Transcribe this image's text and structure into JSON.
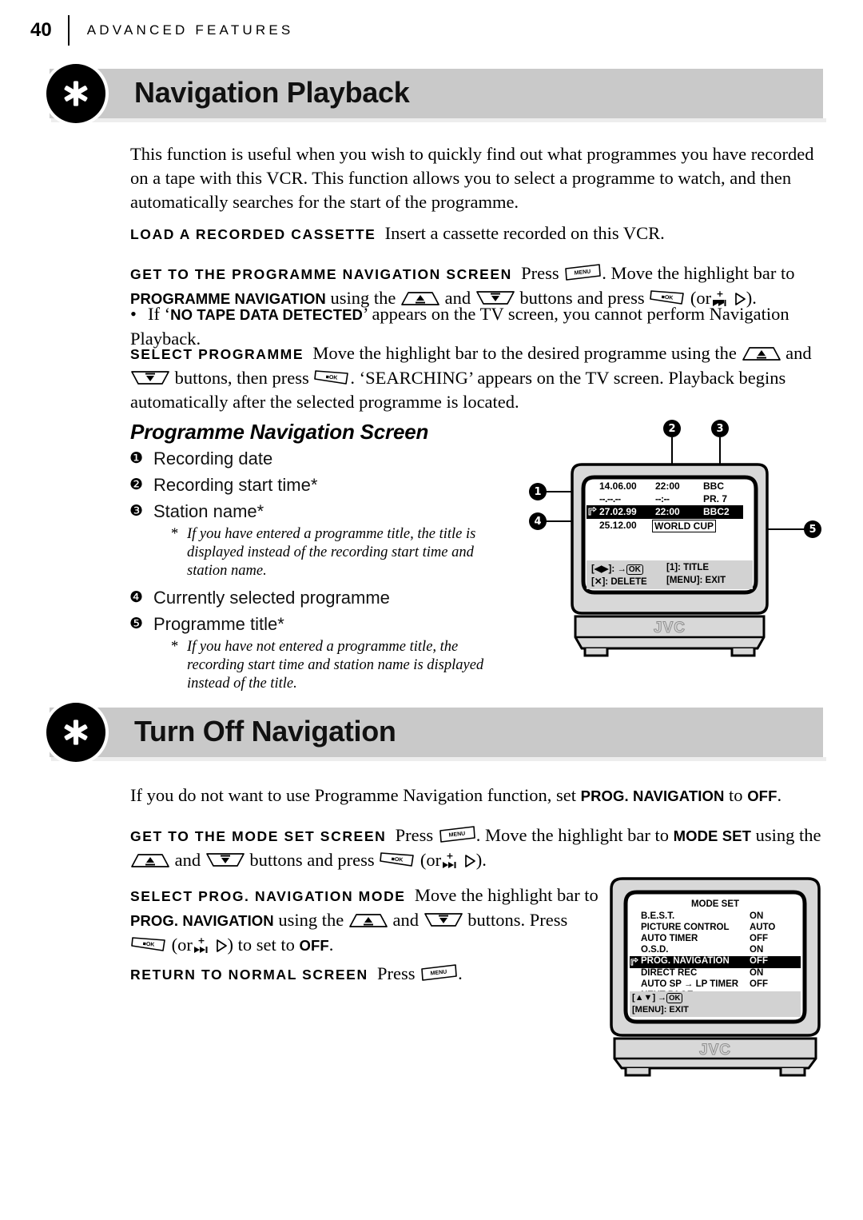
{
  "runhead": {
    "page_number": "40",
    "section": "ADVANCED FEATURES"
  },
  "sections": [
    {
      "id": "navigation-playback",
      "badge_icon": "asterisk-icon",
      "title": "Navigation Playback"
    },
    {
      "id": "turn-off-navigation",
      "badge_icon": "asterisk-icon",
      "title": "Turn Off Navigation"
    }
  ],
  "intro": {
    "line1": "This function is useful when you wish to quickly find out what programmes you have recorded",
    "line2": "on a tape with this VCR. This function allows you to select a programme to watch, and then",
    "line3": "automatically searches for the start of the programme."
  },
  "steps": {
    "load_cassette": {
      "lead": "LOAD A RECORDED CASSETTE",
      "body": "Insert a cassette recorded on this VCR."
    },
    "get_to_nav_screen": {
      "lead": "GET TO THE PROGRAMME NAVIGATION SCREEN",
      "body_a": "Press",
      "key_menu": "MENU",
      "body_b": ". Move the highlight bar to",
      "bold_target": "PROGRAMME NAVIGATION",
      "body_c": "using the",
      "key_up": "up-trapezoid-button",
      "body_d": "and",
      "key_down": "down-trapezoid-button",
      "body_e": "buttons and press",
      "key_ok": "OK",
      "body_f": "(or",
      "key_skip": "skip-forward-button",
      "key_play": "play-button",
      "body_g": ")."
    },
    "nav_note": {
      "dot": "•",
      "text_a": "If ‘",
      "bold": "NO TAPE DATA DETECTED",
      "text_b": "’ appears on the TV screen, you cannot perform Navigation Playback."
    },
    "select_programme": {
      "lead": "SELECT PROGRAMME",
      "body_a": "Move the highlight bar to the desired programme using the",
      "body_b": "and",
      "body_c": "buttons, then press",
      "body_d": ". ‘SEARCHING’ appears on the TV screen. Playback begins",
      "body_e": "automatically after the selected programme is located."
    },
    "get_to_mode_set": {
      "lead": "GET TO THE MODE SET SCREEN",
      "body_a": "Press",
      "body_b": ". Move the highlight bar to",
      "bold_target": "MODE SET",
      "body_c": "using the",
      "body_d": "and",
      "body_e": "buttons and press",
      "body_f": "(or",
      "body_g": ")."
    },
    "select_prog_nav_mode": {
      "lead": "SELECT PROG. NAVIGATION MODE",
      "body_a": "Move the highlight bar to",
      "bold_target": "PROG. NAVIGATION",
      "body_b": "using the",
      "body_c": "and",
      "body_d": "buttons. Press",
      "body_e": "(or",
      "body_f": ") to set to",
      "bold_off": "OFF",
      "body_g": "."
    },
    "return_normal": {
      "lead": "RETURN TO NORMAL SCREEN",
      "body_a": "Press",
      "body_b": "."
    }
  },
  "turn_off_intro": {
    "text_a": "If you do not want to use Programme Navigation function, set",
    "bold_a": "PROG. NAVIGATION",
    "text_b": "to",
    "bold_b": "OFF",
    "text_c": "."
  },
  "programme_nav_screen": {
    "heading": "Programme Navigation Screen",
    "legend": [
      {
        "num": "❶",
        "label": "Recording date",
        "note": null
      },
      {
        "num": "❷",
        "label": "Recording start time*",
        "note": null
      },
      {
        "num": "❸",
        "label": "Station name*",
        "note": "If you have entered a programme title, the title is displayed instead of the recording start time and station name."
      },
      {
        "num": "❹",
        "label": "Currently selected programme",
        "note": null
      },
      {
        "num": "❺",
        "label": "Programme title*",
        "note": "If you have not entered a programme title, the recording start time and station name is displayed instead of the title."
      }
    ],
    "callouts": [
      "1",
      "2",
      "3",
      "4",
      "5"
    ],
    "osd": {
      "rows": [
        {
          "marker": "",
          "date": "14.06.00",
          "time": "22:00",
          "station": "BBC",
          "highlighted": false
        },
        {
          "marker": "",
          "date": "--.--.--",
          "time": "--:--",
          "station": "PR. 7",
          "highlighted": false
        },
        {
          "marker": "hand-pointer-icon",
          "date": "27.02.99",
          "time": "22:00",
          "station": "BBC2",
          "highlighted": true
        },
        {
          "marker": "",
          "date": "25.12.00",
          "time": "WORLD CUP",
          "station": "",
          "highlighted": false
        }
      ],
      "footer": {
        "left_top": "[◀▶]: →",
        "left_top_key": "OK",
        "left_bottom": "[✕]: DELETE",
        "right_top": "[1]: TITLE",
        "right_bottom": "[MENU]: EXIT"
      },
      "brand": "JVC"
    }
  },
  "mode_set_screen": {
    "title": "MODE SET",
    "rows": [
      {
        "marker": "",
        "label": "B.E.S.T.",
        "value": "ON",
        "highlighted": false
      },
      {
        "marker": "",
        "label": "PICTURE CONTROL",
        "value": "AUTO",
        "highlighted": false
      },
      {
        "marker": "",
        "label": "AUTO TIMER",
        "value": "OFF",
        "highlighted": false
      },
      {
        "marker": "",
        "label": "O.S.D.",
        "value": "ON",
        "highlighted": false
      },
      {
        "marker": "hand-pointer-icon",
        "label": "PROG. NAVIGATION",
        "value": "OFF",
        "highlighted": true
      },
      {
        "marker": "",
        "label": "DIRECT REC",
        "value": "ON",
        "highlighted": false
      },
      {
        "marker": "",
        "label": "AUTO SP → LP TIMER",
        "value": "OFF",
        "highlighted": false
      },
      {
        "marker": "",
        "label": "NEXT PAGE",
        "value": "",
        "highlighted": false
      }
    ],
    "footer": {
      "left_top": "[▲▼] →",
      "left_top_key": "OK",
      "left_bottom": "[MENU]: EXIT"
    },
    "brand": "JVC"
  },
  "colors": {
    "banner_bar": "#c9c9c9",
    "banner_shadow": "#ededed",
    "tv_body": "#d8d8d8",
    "osd_footer": "#d2d2d2",
    "highlight": "#000000"
  }
}
